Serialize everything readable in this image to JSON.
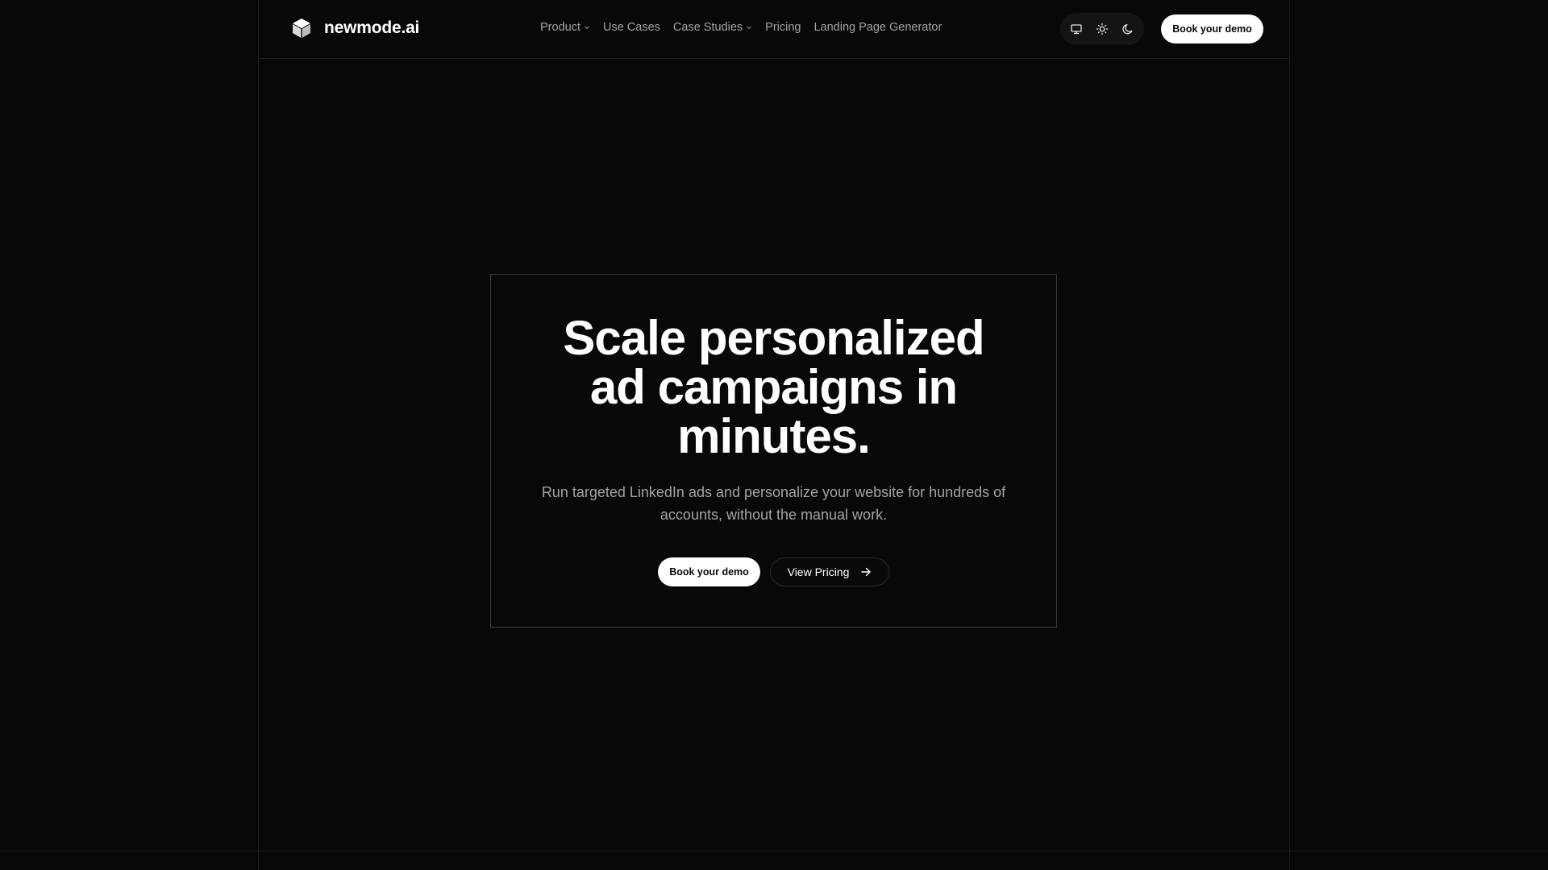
{
  "brand": {
    "name": "newmode.ai",
    "logo_icon": "cube-icon"
  },
  "nav": {
    "items": [
      {
        "label": "Product",
        "has_dropdown": true
      },
      {
        "label": "Use Cases",
        "has_dropdown": false
      },
      {
        "label": "Case Studies",
        "has_dropdown": true
      },
      {
        "label": "Pricing",
        "has_dropdown": false
      },
      {
        "label": "Landing Page Generator",
        "has_dropdown": false
      }
    ]
  },
  "theme_switcher": {
    "options": [
      {
        "icon": "monitor-icon"
      },
      {
        "icon": "sun-icon"
      },
      {
        "icon": "moon-icon"
      }
    ]
  },
  "header": {
    "cta_label": "Book your demo"
  },
  "hero": {
    "title_lines": [
      "Scale personalized",
      "ad campaigns in",
      "minutes."
    ],
    "subtitle": "Run targeted LinkedIn ads and personalize your website for hundreds of accounts, without the manual work.",
    "primary_cta": "Book your demo",
    "secondary_cta": "View Pricing",
    "secondary_cta_icon": "arrow-right-icon"
  },
  "colors": {
    "background": "#080808",
    "text": "#ffffff",
    "muted_text": "#a3a3a3",
    "border": "#3a3a3a",
    "button_bg": "#ffffff",
    "button_text": "#0a0a0a"
  }
}
